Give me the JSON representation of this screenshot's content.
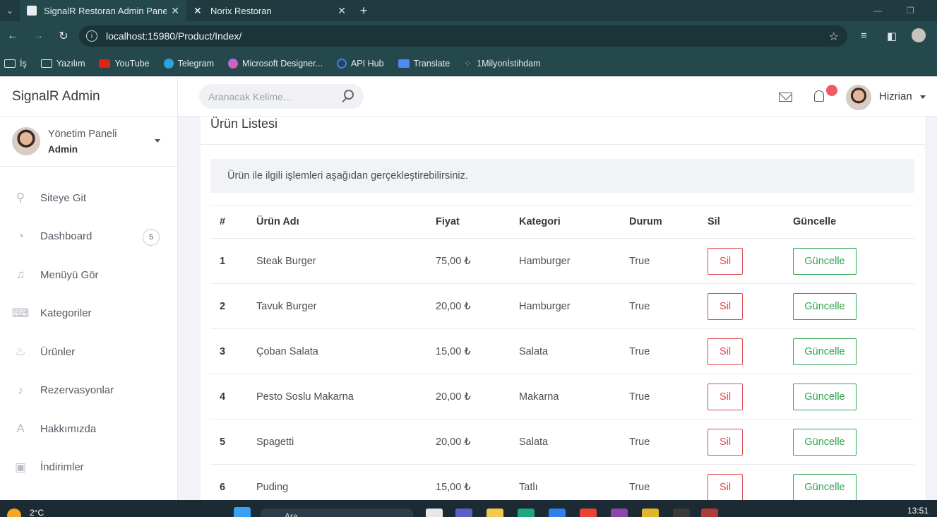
{
  "browser": {
    "tabs": [
      {
        "title": "SignalR Restoran Admin Paneli",
        "active": true
      },
      {
        "title": "Norix Restoran",
        "active": false
      }
    ],
    "url": "localhost:15980/Product/Index/",
    "bookmarks": [
      "İş",
      "Yazılım",
      "YouTube",
      "Telegram",
      "Microsoft Designer...",
      "API Hub",
      "Translate",
      "1Milyonİstihdam"
    ]
  },
  "sidebar": {
    "brand": "SignalR Admin",
    "profile": {
      "name": "Yönetim Paneli",
      "role": "Admin"
    },
    "items": [
      {
        "label": "Siteye Git",
        "icon": "bicycle-icon"
      },
      {
        "label": "Dashboard",
        "icon": "speedometer-icon",
        "badge": "5"
      },
      {
        "label": "Menüyü Gör",
        "icon": "music-icon"
      },
      {
        "label": "Kategoriler",
        "icon": "keyboard-icon"
      },
      {
        "label": "Ürünler",
        "icon": "cake-icon"
      },
      {
        "label": "Rezervasyonlar",
        "icon": "bell-icon"
      },
      {
        "label": "Hakkımızda",
        "icon": "text-a-icon"
      },
      {
        "label": "İndirimler",
        "icon": "camera-icon"
      }
    ]
  },
  "topbar": {
    "search_placeholder": "Aranacak Kelime...",
    "user_name": "Hizrian"
  },
  "main": {
    "title": "Ürün Listesi",
    "info": "Ürün ile ilgili işlemleri aşağıdan gerçekleştirebilirsiniz.",
    "columns": [
      "#",
      "Ürün Adı",
      "Fiyat",
      "Kategori",
      "Durum",
      "Sil",
      "Güncelle"
    ],
    "rows": [
      {
        "id": "1",
        "name": "Steak Burger",
        "price": "75,00 ₺",
        "category": "Hamburger",
        "status": "True"
      },
      {
        "id": "2",
        "name": "Tavuk Burger",
        "price": "20,00 ₺",
        "category": "Hamburger",
        "status": "True"
      },
      {
        "id": "3",
        "name": "Çoban Salata",
        "price": "15,00 ₺",
        "category": "Salata",
        "status": "True"
      },
      {
        "id": "4",
        "name": "Pesto Soslu Makarna",
        "price": "20,00 ₺",
        "category": "Makarna",
        "status": "True"
      },
      {
        "id": "5",
        "name": "Spagetti",
        "price": "20,00 ₺",
        "category": "Salata",
        "status": "True"
      },
      {
        "id": "6",
        "name": "Puding",
        "price": "15,00 ₺",
        "category": "Tatlı",
        "status": "True"
      }
    ],
    "delete_label": "Sil",
    "update_label": "Güncelle"
  },
  "taskbar": {
    "temperature": "2°C",
    "search_label": "Ara",
    "time": "13:51"
  },
  "colors": {
    "danger": "#e0484f",
    "success": "#2da44e",
    "notification": "#f05a63",
    "browser_chrome": "#24484c"
  }
}
